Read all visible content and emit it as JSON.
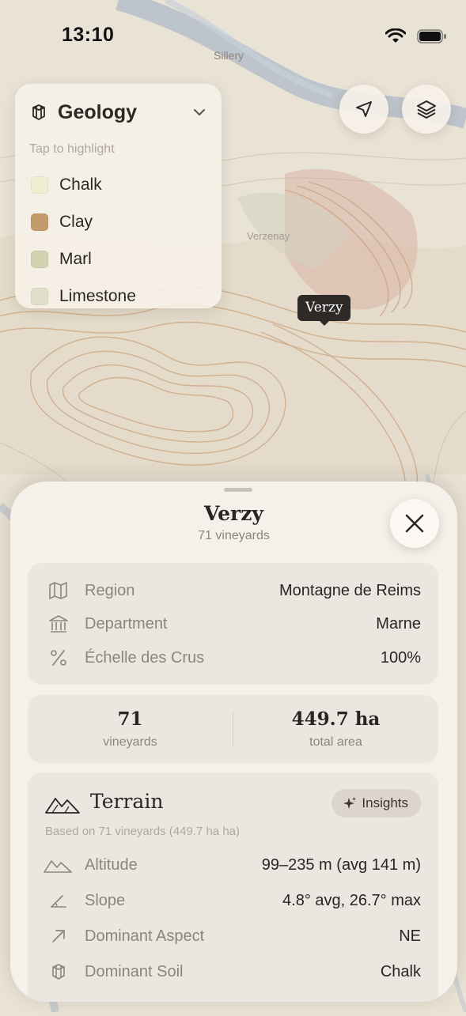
{
  "status_bar": {
    "time": "13:10"
  },
  "map": {
    "place_labels": {
      "sillery": "Sillery",
      "verzenay": "Verzenay"
    },
    "pin_label": "Verzy"
  },
  "legend": {
    "title": "Geology",
    "hint": "Tap to highlight",
    "items": [
      {
        "label": "Chalk",
        "color": "#f1edd3"
      },
      {
        "label": "Clay",
        "color": "#c49c6c"
      },
      {
        "label": "Marl",
        "color": "#d3d2b2"
      },
      {
        "label": "Limestone",
        "color": "#e0dfcb"
      }
    ]
  },
  "sheet": {
    "title": "Verzy",
    "subtitle": "71 vineyards",
    "info": [
      {
        "icon": "map-icon",
        "label": "Region",
        "value": "Montagne de Reims"
      },
      {
        "icon": "building-icon",
        "label": "Department",
        "value": "Marne"
      },
      {
        "icon": "percent-icon",
        "label": "Échelle des Crus",
        "value": "100%"
      }
    ],
    "stats": [
      {
        "value": "71",
        "label": "vineyards"
      },
      {
        "value": "449.7 ha",
        "label": "total area"
      }
    ],
    "terrain": {
      "title": "Terrain",
      "insights_label": "Insights",
      "note": "Based on 71 vineyards (449.7 ha ha)",
      "rows": [
        {
          "icon": "mountain-icon",
          "label": "Altitude",
          "value": "99–235 m (avg 141 m)"
        },
        {
          "icon": "angle-icon",
          "label": "Slope",
          "value": "4.8° avg, 26.7° max"
        },
        {
          "icon": "arrow-up-right-icon",
          "label": "Dominant Aspect",
          "value": "NE"
        },
        {
          "icon": "layers-cube-icon",
          "label": "Dominant Soil",
          "value": "Chalk"
        }
      ]
    }
  },
  "colors": {
    "map_base": "#e9e3d6",
    "contour": "#c9a27c",
    "river": "#a9b7c6",
    "sheet_bg": "#f5f0e9",
    "card_bg": "#ebe6df"
  }
}
